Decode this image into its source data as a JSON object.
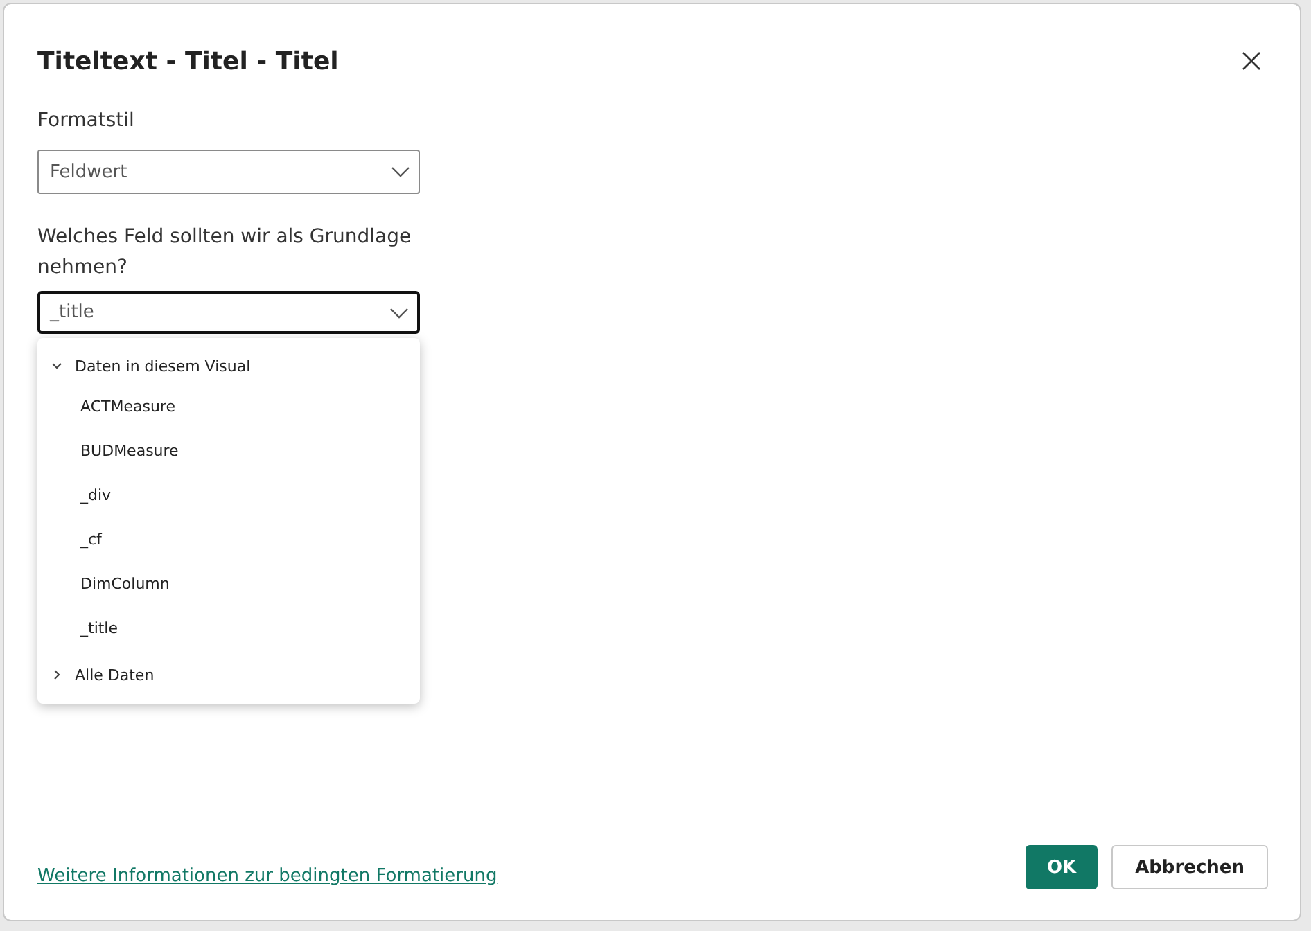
{
  "dialog": {
    "title": "Titeltext - Titel - Titel"
  },
  "format_style": {
    "label": "Formatstil",
    "value": "Feldwert"
  },
  "field": {
    "label": "Welches Feld sollten wir als Grundlage nehmen?",
    "value": "_title",
    "expanded": true
  },
  "field_list": [
    {
      "label": "Daten in diesem Visual",
      "expanded": true,
      "children": [
        {
          "label": "ACTMeasure"
        },
        {
          "label": "BUDMeasure"
        },
        {
          "label": "_div"
        },
        {
          "label": "_cf"
        },
        {
          "label": "DimColumn"
        },
        {
          "label": "_title"
        }
      ]
    },
    {
      "label": "Alle Daten",
      "expanded": false
    }
  ],
  "link": "Weitere Informationen zur bedingten Formatierung",
  "buttons": [
    {
      "label": "OK",
      "kind": "primary"
    },
    {
      "label": "Abbrechen",
      "kind": "secondary"
    }
  ]
}
